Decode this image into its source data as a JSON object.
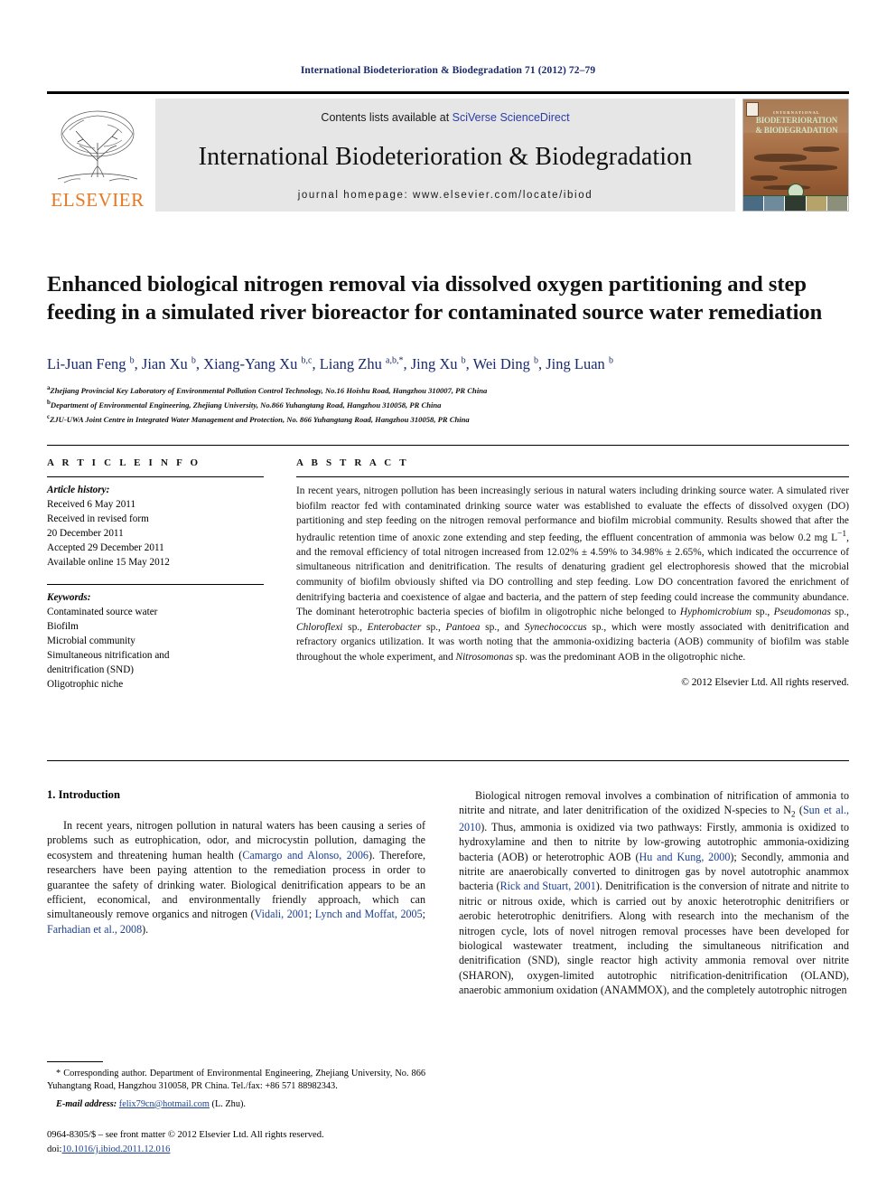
{
  "running_head": "International Biodeterioration & Biodegradation 71 (2012) 72–79",
  "masthead": {
    "publisher_name": "ELSEVIER",
    "contents_prefix": "Contents lists available at ",
    "contents_link": "SciVerse ScienceDirect",
    "journal_title": "International Biodeterioration & Biodegradation",
    "homepage_label": "journal homepage: www.elsevier.com/locate/ibiod",
    "cover": {
      "supertitle": "INTERNATIONAL",
      "title_line1": "BIODETERIORATION",
      "title_line2": "& BIODEGRADATION"
    },
    "band_color": "#e6e6e6",
    "link_color": "#2b3ca8",
    "elsevier_orange": "#e87722"
  },
  "article": {
    "title": "Enhanced biological nitrogen removal via dissolved oxygen partitioning and step feeding in a simulated river bioreactor for contaminated source water remediation",
    "authors_html": "Li-Juan Feng <sup>b</sup>, Jian Xu <sup>b</sup>, Xiang-Yang Xu <sup>b,c</sup>, Liang Zhu <sup>a,b,</sup><sup>*</sup>, Jing Xu <sup>b</sup>, Wei Ding <sup>b</sup>, Jing Luan <sup>b</sup>",
    "affiliations": [
      {
        "marker": "a",
        "text": "Zhejiang Provincial Key Laboratory of Environmental Pollution Control Technology, No.16 Hoishu Road, Hangzhou 310007, PR China"
      },
      {
        "marker": "b",
        "text": "Department of Environmental Engineering, Zhejiang University, No.866 Yuhangtang Road, Hangzhou 310058, PR China"
      },
      {
        "marker": "c",
        "text": "ZJU-UWA Joint Centre in Integrated Water Management and Protection, No. 866 Yuhangtang Road, Hangzhou 310058, PR China"
      }
    ]
  },
  "article_info": {
    "label": "A R T I C L E  I N F O",
    "history_head": "Article history:",
    "history_lines": [
      "Received 6 May 2011",
      "Received in revised form",
      "20 December 2011",
      "Accepted 29 December 2011",
      "Available online 15 May 2012"
    ],
    "keywords_head": "Keywords:",
    "keywords": [
      "Contaminated source water",
      "Biofilm",
      "Microbial community",
      "Simultaneous nitrification and",
      "denitrification (SND)",
      "Oligotrophic niche"
    ]
  },
  "abstract": {
    "label": "A B S T R A C T",
    "paragraph_html": "In recent years, nitrogen pollution has been increasingly serious in natural waters including drinking source water. A simulated river biofilm reactor fed with contaminated drinking source water was established to evaluate the effects of dissolved oxygen (DO) partitioning and step feeding on the nitrogen removal performance and biofilm microbial community. Results showed that after the hydraulic retention time of anoxic zone extending and step feeding, the effluent concentration of ammonia was below 0.2 mg L<sup>&#8722;1</sup>, and the removal efficiency of total nitrogen increased from 12.02% &#177; 4.59% to 34.98% &#177; 2.65%, which indicated the occurrence of simultaneous nitrification and denitrification. The results of denaturing gradient gel electrophoresis showed that the microbial community of biofilm obviously shifted via DO controlling and step feeding. Low DO concentration favored the enrichment of denitrifying bacteria and coexistence of algae and bacteria, and the pattern of step feeding could increase the community abundance. The dominant heterotrophic bacteria species of biofilm in oligotrophic niche belonged to <i>Hyphomicrobium</i> sp., <i>Pseudomonas</i> sp., <i>Chloroflexi</i> sp., <i>Enterobacter</i> sp., <i>Pantoea</i> sp., and <i>Synechococcus</i> sp., which were mostly associated with denitrification and refractory organics utilization. It was worth noting that the ammonia-oxidizing bacteria (AOB) community of biofilm was stable throughout the whole experiment, and <i>Nitrosomonas</i> sp. was the predominant AOB in the oligotrophic niche.",
    "copyright": "© 2012 Elsevier Ltd. All rights reserved."
  },
  "body": {
    "section_heading": "1.  Introduction",
    "left_paragraph_html": "In recent years, nitrogen pollution in natural waters has been causing a series of problems such as eutrophication, odor, and microcystin pollution, damaging the ecosystem and threatening human health (<span class=\"cite\">Camargo and Alonso, 2006</span>). Therefore, researchers have been paying attention to the remediation process in order to guarantee the safety of drinking water. Biological denitrification appears to be an efficient, economical, and environmentally friendly approach, which can simultaneously remove organics and nitrogen (<span class=\"cite\">Vidali, 2001</span>; <span class=\"cite\">Lynch and Moffat, 2005</span>; <span class=\"cite\">Farhadian et al., 2008</span>).",
    "right_paragraph_html": "Biological nitrogen removal involves a combination of nitrification of ammonia to nitrite and nitrate, and later denitrification of the oxidized N-species to N<sub>2</sub> (<span class=\"cite\">Sun et al., 2010</span>). Thus, ammonia is oxidized via two pathways: Firstly, ammonia is oxidized to hydroxylamine and then to nitrite by low-growing autotrophic ammonia-oxidizing bacteria (AOB) or heterotrophic AOB (<span class=\"cite\">Hu and Kung, 2000</span>); Secondly, ammonia and nitrite are anaerobically converted to dinitrogen gas by novel autotrophic anammox bacteria (<span class=\"cite\">Rick and Stuart, 2001</span>). Denitrification is the conversion of nitrate and nitrite to nitric or nitrous oxide, which is carried out by anoxic heterotrophic denitrifiers or aerobic heterotrophic denitrifiers. Along with research into the mechanism of the nitrogen cycle, lots of novel nitrogen removal processes have been developed for biological wastewater treatment, including the simultaneous nitrification and denitrification (SND), single reactor high activity ammonia removal over nitrite (SHARON), oxygen-limited autotrophic nitrification-denitrification (OLAND), anaerobic ammonium oxidation (ANAMMOX), and the completely autotrophic nitrogen"
  },
  "footnote": {
    "corresponding_html": "* Corresponding author. Department of Environmental Engineering, Zhejiang University, No. 866 Yuhangtang Road, Hangzhou 310058, PR China. Tel./fax: +86 571 88982343.",
    "email_label": "E-mail address:",
    "email": "felix79cn@hotmail.com",
    "email_suffix": "(L. Zhu)."
  },
  "imprint": {
    "issn_line": "0964-8305/$ – see front matter © 2012 Elsevier Ltd. All rights reserved.",
    "doi_prefix": "doi:",
    "doi": "10.1016/j.ibiod.2011.12.016"
  }
}
